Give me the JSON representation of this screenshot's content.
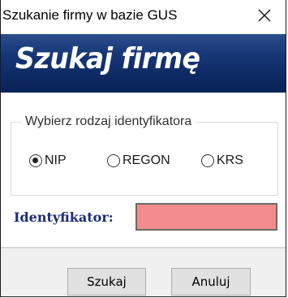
{
  "window": {
    "title": "Szukanie firmy w bazie GUS"
  },
  "banner": {
    "text": "Szukaj firmę"
  },
  "identifier_group": {
    "legend": "Wybierz rodzaj identyfikatora",
    "options": [
      {
        "label": "NIP",
        "checked": true
      },
      {
        "label": "REGON",
        "checked": false
      },
      {
        "label": "KRS",
        "checked": false
      }
    ]
  },
  "identifier_field": {
    "label": "Identyfikator:",
    "value": ""
  },
  "buttons": {
    "search_label": "Szukaj",
    "cancel_label": "Anuluj"
  },
  "colors": {
    "banner_blue": "#173777",
    "field_required": "#f28b8b",
    "label_navy": "#1c2c78"
  }
}
